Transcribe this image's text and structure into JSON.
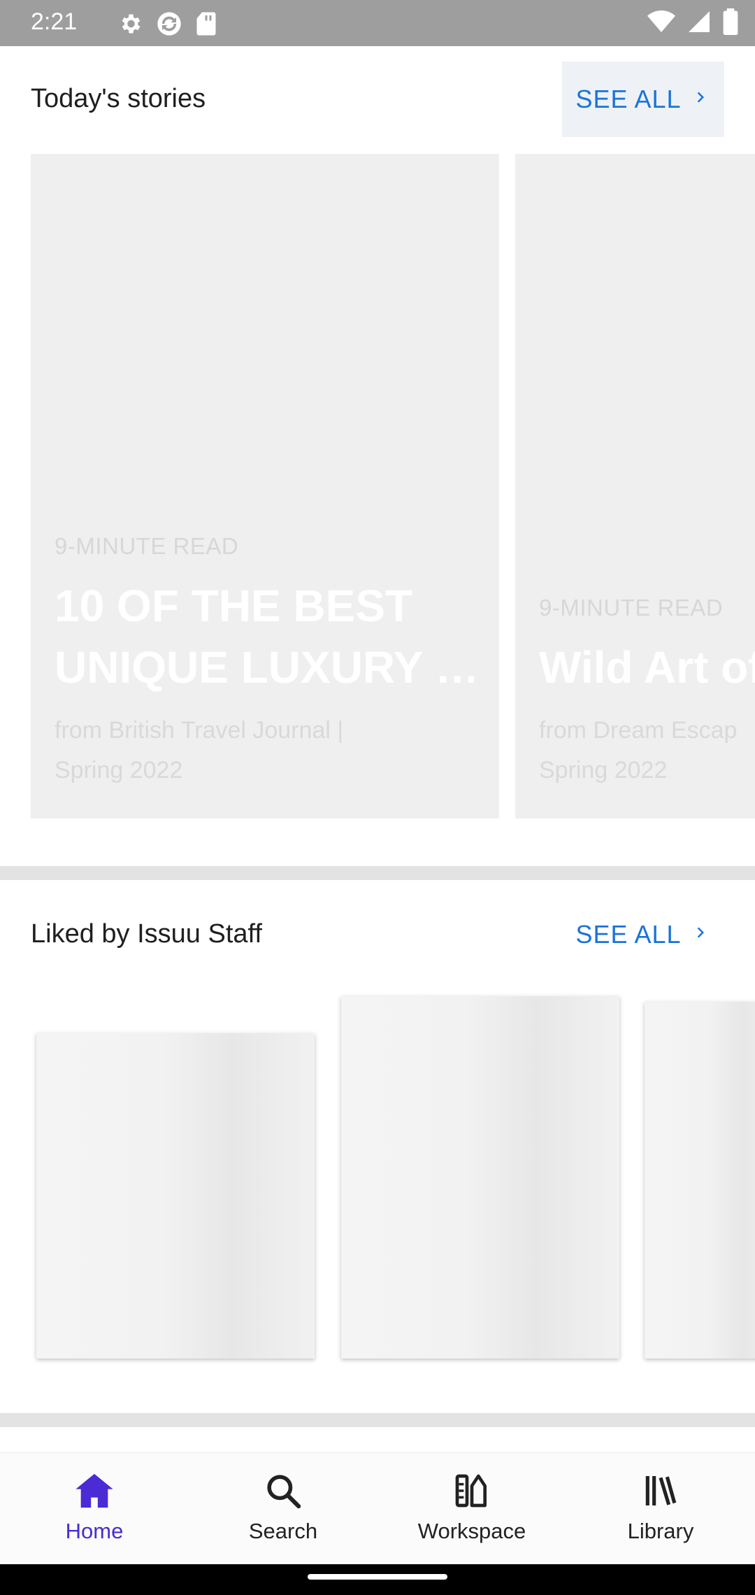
{
  "status_bar": {
    "time": "2:21",
    "icons": [
      "gear-icon",
      "sync-icon",
      "sd-card-icon",
      "wifi-icon",
      "signal-icon",
      "battery-icon"
    ]
  },
  "sections": {
    "today": {
      "title": "Today's stories",
      "see_all": "SEE ALL"
    },
    "liked": {
      "title": "Liked by Issuu Staff",
      "see_all": "SEE ALL"
    }
  },
  "stories": [
    {
      "read_time": "9-MINUTE READ",
      "headline_line1": "10 OF THE BEST",
      "headline_line2": "UNIQUE LUXURY …",
      "from_line1": "from British Travel Journal |",
      "from_line2": "Spring 2022"
    },
    {
      "read_time": "9-MINUTE READ",
      "headline_line1": "Wild Art of",
      "from_line1": "from Dream Escap",
      "from_line2": "Spring 2022"
    }
  ],
  "nav": {
    "items": [
      {
        "label": "Home",
        "icon": "home-icon",
        "active": true
      },
      {
        "label": "Search",
        "icon": "search-icon",
        "active": false
      },
      {
        "label": "Workspace",
        "icon": "workspace-icon",
        "active": false
      },
      {
        "label": "Library",
        "icon": "library-icon",
        "active": false
      }
    ]
  },
  "colors": {
    "accent": "#1a73d9",
    "nav_active": "#4a2bd6",
    "status_bar": "#9e9e9e"
  }
}
